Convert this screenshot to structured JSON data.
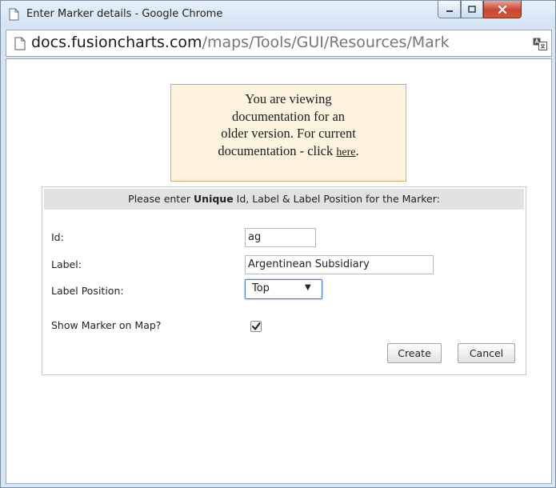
{
  "window": {
    "title": "Enter Marker details - Google Chrome"
  },
  "address_bar": {
    "domain": "docs.fusioncharts.com",
    "path": "/maps/Tools/GUI/Resources/Mark"
  },
  "notice": {
    "line1": "You are viewing",
    "line2": "documentation for an",
    "line3": "older version. For current",
    "line4_prefix": "documentation - click ",
    "link_text": "here",
    "line4_suffix": "."
  },
  "form": {
    "header_prefix": "Please enter ",
    "header_bold": "Unique",
    "header_suffix": " Id, Label & Label Position for the Marker:",
    "id_label": "Id:",
    "id_value": "ag",
    "label_label": "Label:",
    "label_value": "Argentinean Subsidiary",
    "position_label": "Label Position:",
    "position_value": "Top",
    "show_label": "Show Marker on Map?",
    "show_checked": true,
    "create_label": "Create",
    "cancel_label": "Cancel"
  },
  "colors": {
    "notice_bg": "#fdf3df",
    "notice_border": "#e6a860",
    "header_bg": "#e2e2e2",
    "close_button": "#c9452e"
  },
  "icons": {
    "title_page": "page-icon",
    "address_page": "page-icon",
    "translate": "translate-icon",
    "dropdown": "chevron-down-icon",
    "checkbox": "checkmark-icon"
  }
}
